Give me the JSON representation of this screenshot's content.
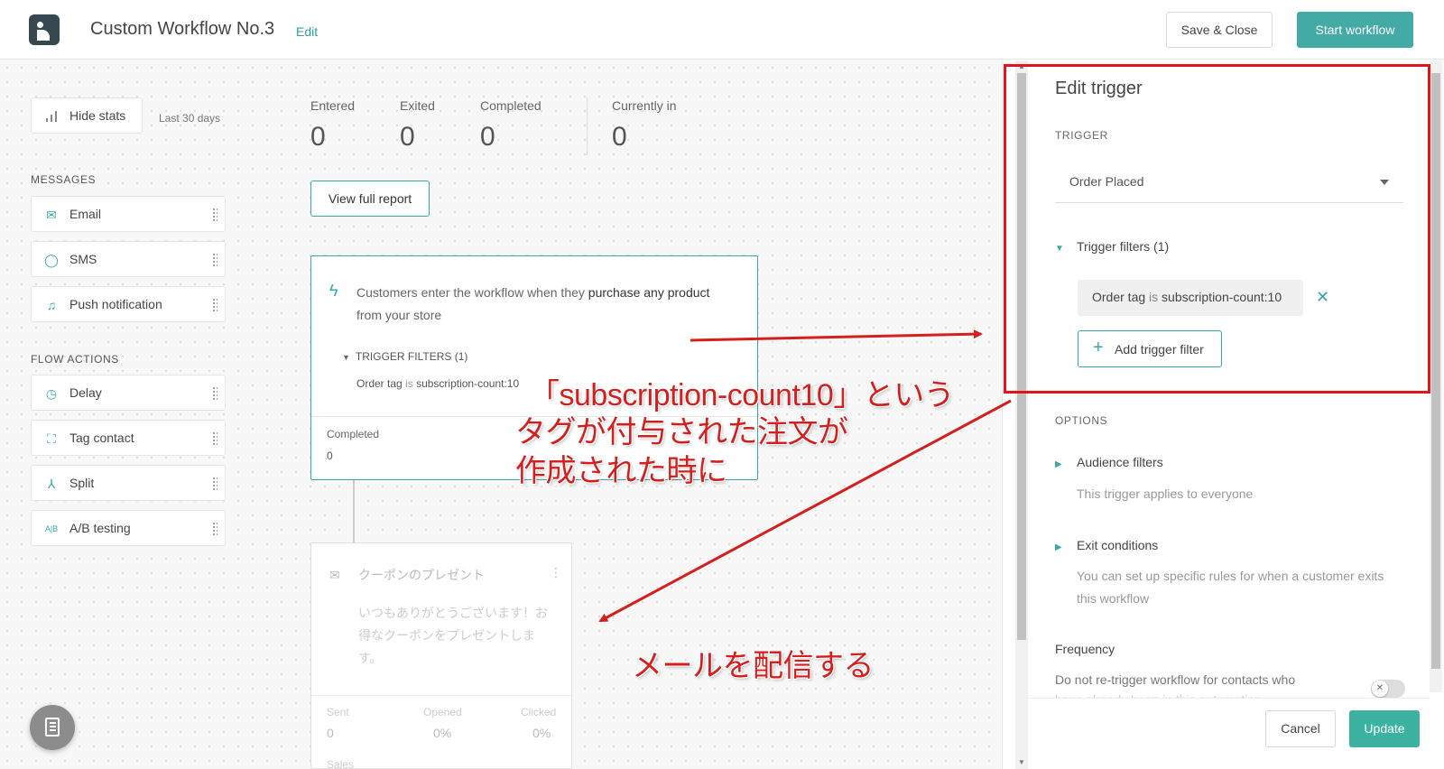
{
  "header": {
    "title": "Custom Workflow No.3",
    "edit_label": "Edit",
    "save_close_label": "Save & Close",
    "start_label": "Start workflow"
  },
  "sidebar": {
    "hide_stats_label": "Hide stats",
    "range_label": "Last 30 days",
    "messages_heading": "MESSAGES",
    "messages": [
      {
        "label": "Email",
        "icon": "envelope-icon"
      },
      {
        "label": "SMS",
        "icon": "chat-bubble-icon"
      },
      {
        "label": "Push notification",
        "icon": "bell-icon"
      }
    ],
    "flow_heading": "FLOW ACTIONS",
    "flow_actions": [
      {
        "label": "Delay",
        "icon": "clock-icon"
      },
      {
        "label": "Tag contact",
        "icon": "tag-contact-icon"
      },
      {
        "label": "Split",
        "icon": "split-icon"
      },
      {
        "label": "A/B testing",
        "icon": "ab-icon"
      }
    ]
  },
  "stats": [
    {
      "label": "Entered",
      "value": "0"
    },
    {
      "label": "Exited",
      "value": "0"
    },
    {
      "label": "Completed",
      "value": "0"
    },
    {
      "label": "Currently in",
      "value": "0"
    }
  ],
  "view_report_label": "View full report",
  "trigger_card": {
    "desc_prefix": "Customers enter the workflow when they ",
    "desc_bold": "purchase any product",
    "desc_suffix": "from your store",
    "filters_heading": "TRIGGER FILTERS (1)",
    "filter_key": "Order tag",
    "filter_op": "is",
    "filter_value": "subscription-count:10",
    "completed_label": "Completed",
    "completed_value": "0"
  },
  "email_card": {
    "name": "クーポンのプレゼント",
    "body": "いつもありがとうございます！お得なクーポンをプレゼントします。",
    "metrics": [
      {
        "label": "Sent",
        "value": "0"
      },
      {
        "label": "Opened",
        "value": "0%"
      },
      {
        "label": "Clicked",
        "value": "0%"
      }
    ],
    "sales_label": "Sales"
  },
  "annotations": {
    "line1": "「subscription-count10」という",
    "line2": "タグが付与された注文が",
    "line3": "作成された時に",
    "line4": "メールを配信する",
    "color": "#d41f1f"
  },
  "panel": {
    "title": "Edit trigger",
    "trigger_heading": "TRIGGER",
    "trigger_value": "Order Placed",
    "filters_label": "Trigger filters (1)",
    "chip_key": "Order tag",
    "chip_op": "is",
    "chip_value": "subscription-count:10",
    "add_filter_label": "Add trigger filter",
    "options_heading": "OPTIONS",
    "audience_label": "Audience filters",
    "audience_note": "This trigger applies to everyone",
    "exit_label": "Exit conditions",
    "exit_note": "You can set up specific rules for when a customer exits this workflow",
    "frequency_label": "Frequency",
    "frequency_desc": "Do not re-trigger workflow for contacts who",
    "frequency_desc_cont": "have already been in this automation",
    "cancel_label": "Cancel",
    "update_label": "Update"
  },
  "colors": {
    "accent": "#43aaa6",
    "update": "#3bb3a0",
    "highlight_box": "#e3141b"
  }
}
